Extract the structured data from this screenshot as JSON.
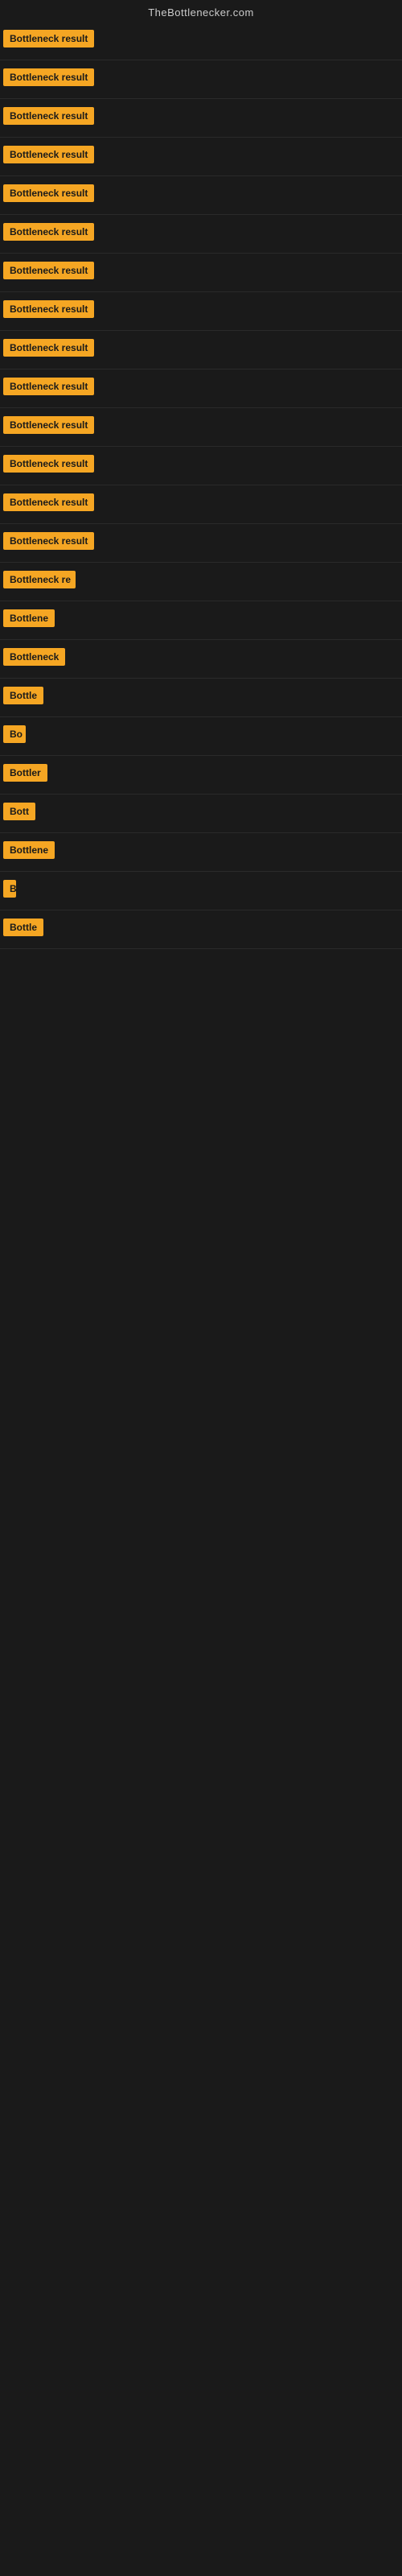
{
  "site": {
    "title": "TheBottlenecker.com"
  },
  "rows": [
    {
      "id": 1,
      "label": "Bottleneck result",
      "width": 120
    },
    {
      "id": 2,
      "label": "Bottleneck result",
      "width": 120
    },
    {
      "id": 3,
      "label": "Bottleneck result",
      "width": 120
    },
    {
      "id": 4,
      "label": "Bottleneck result",
      "width": 120
    },
    {
      "id": 5,
      "label": "Bottleneck result",
      "width": 120
    },
    {
      "id": 6,
      "label": "Bottleneck result",
      "width": 120
    },
    {
      "id": 7,
      "label": "Bottleneck result",
      "width": 120
    },
    {
      "id": 8,
      "label": "Bottleneck result",
      "width": 120
    },
    {
      "id": 9,
      "label": "Bottleneck result",
      "width": 120
    },
    {
      "id": 10,
      "label": "Bottleneck result",
      "width": 120
    },
    {
      "id": 11,
      "label": "Bottleneck result",
      "width": 120
    },
    {
      "id": 12,
      "label": "Bottleneck result",
      "width": 115
    },
    {
      "id": 13,
      "label": "Bottleneck result",
      "width": 120
    },
    {
      "id": 14,
      "label": "Bottleneck result",
      "width": 115
    },
    {
      "id": 15,
      "label": "Bottleneck re",
      "width": 90
    },
    {
      "id": 16,
      "label": "Bottlene",
      "width": 72
    },
    {
      "id": 17,
      "label": "Bottleneck",
      "width": 80
    },
    {
      "id": 18,
      "label": "Bottle",
      "width": 55
    },
    {
      "id": 19,
      "label": "Bo",
      "width": 28
    },
    {
      "id": 20,
      "label": "Bottler",
      "width": 56
    },
    {
      "id": 21,
      "label": "Bott",
      "width": 42
    },
    {
      "id": 22,
      "label": "Bottlene",
      "width": 68
    },
    {
      "id": 23,
      "label": "B",
      "width": 16
    },
    {
      "id": 24,
      "label": "Bottle",
      "width": 52
    }
  ]
}
